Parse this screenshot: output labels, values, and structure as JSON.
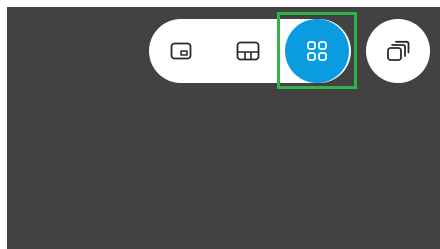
{
  "toolbar": {
    "buttons": [
      {
        "icon": "picture-in-picture-icon",
        "selected": false
      },
      {
        "icon": "bottom-dock-layout-icon",
        "selected": false
      },
      {
        "icon": "grid-layout-icon",
        "selected": true
      },
      {
        "icon": "stacked-windows-icon",
        "selected": false
      }
    ]
  },
  "colors": {
    "background": "#424242",
    "pill": "#ffffff",
    "selected": "#0a9be0",
    "highlight": "#2db54a",
    "icon_dark": "#2a2a2a",
    "icon_light": "#ffffff"
  }
}
